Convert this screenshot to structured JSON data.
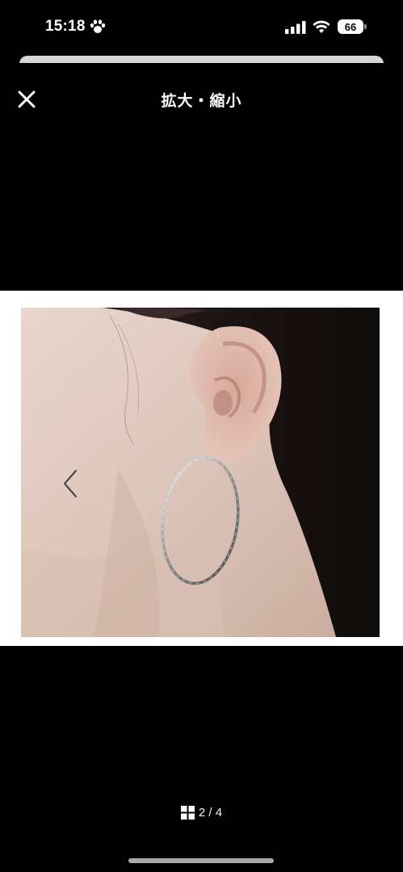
{
  "status_bar": {
    "time": "15:18",
    "battery_level": "66",
    "icons": [
      "paw-icon",
      "signal-icon",
      "wifi-icon",
      "battery-icon"
    ]
  },
  "header": {
    "title": "拡大・縮小",
    "close_icon": "close-icon"
  },
  "viewer": {
    "image_subject": "ear-with-hoop-earring",
    "prev_icon": "chevron-left-icon",
    "background_color": "#000000",
    "frame_color": "#ffffff"
  },
  "pager": {
    "icon": "grid-icon",
    "label": "2 / 4"
  }
}
